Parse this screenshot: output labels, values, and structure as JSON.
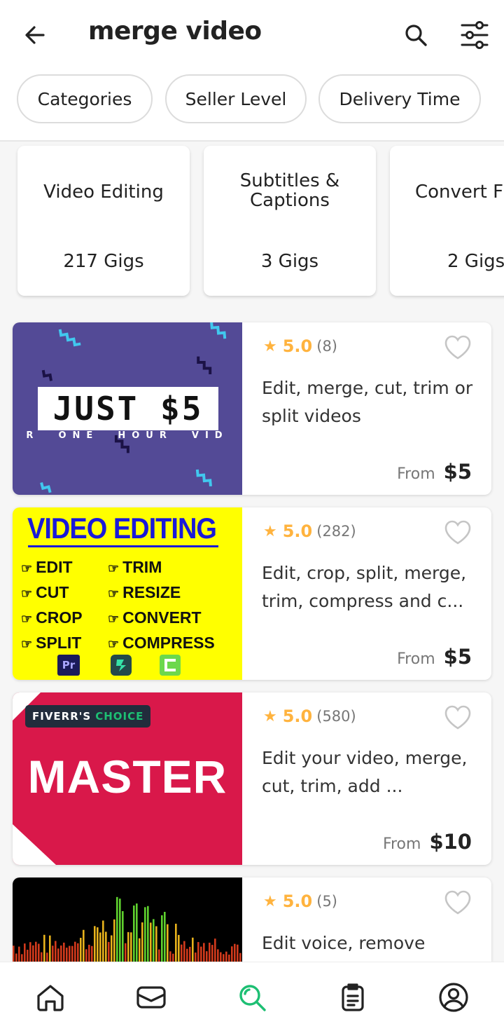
{
  "header": {
    "query": "merge video",
    "icons": {
      "back": "back-arrow-icon",
      "search": "search-icon",
      "filter": "filter-sliders-icon"
    }
  },
  "filters": [
    "Categories",
    "Seller Level",
    "Delivery Time"
  ],
  "categories": [
    {
      "title": "Video Editing",
      "count": "217 Gigs"
    },
    {
      "title": "Subtitles & Captions",
      "count": "3 Gigs"
    },
    {
      "title": "Convert F",
      "count": "2 Gigs"
    }
  ],
  "gigs": [
    {
      "rating": "5.0",
      "reviews": "(8)",
      "title": "Edit, merge, cut, trim or split videos",
      "from": "From",
      "price": "$5",
      "thumb": {
        "headline": "JUST $5",
        "sub": "R  ONE  HOUR  VID"
      }
    },
    {
      "rating": "5.0",
      "reviews": "(282)",
      "title": "Edit, crop, split, merge, trim, compress and c...",
      "from": "From",
      "price": "$5",
      "thumb": {
        "headline": "VIDEO EDITING",
        "left": [
          "EDIT",
          "CUT",
          "CROP",
          "SPLIT"
        ],
        "right": [
          "TRIM",
          "RESIZE",
          "CONVERT",
          "COMPRESS"
        ],
        "badges": [
          "Pr"
        ]
      }
    },
    {
      "rating": "5.0",
      "reviews": "(580)",
      "title": "Edit your video, merge, cut, trim, add ...",
      "from": "From",
      "price": "$10",
      "thumb": {
        "badge_a": "FIVERR'S",
        "badge_b": "CHOICE",
        "headline": "MASTER"
      }
    },
    {
      "rating": "5.0",
      "reviews": "(5)",
      "title": "Edit voice, remove",
      "from": "",
      "price": ""
    }
  ],
  "nav": [
    {
      "icon": "home-icon",
      "active": false
    },
    {
      "icon": "inbox-icon",
      "active": false
    },
    {
      "icon": "search-icon",
      "active": true
    },
    {
      "icon": "orders-icon",
      "active": false
    },
    {
      "icon": "profile-icon",
      "active": false
    }
  ],
  "colors": {
    "accent": "#1dbf73",
    "star": "#ffb33e",
    "gig1_bg": "#534a96",
    "gig2_bg": "#ffff00",
    "gig3_bg": "#d9184a"
  }
}
